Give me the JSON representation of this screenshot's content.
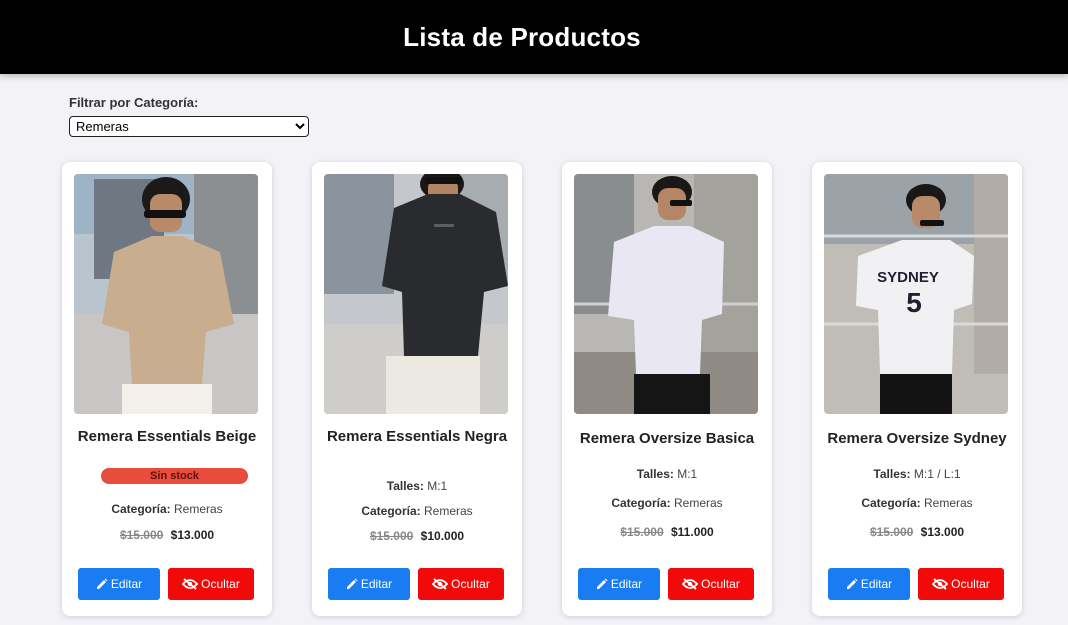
{
  "header": {
    "title": "Lista de Productos"
  },
  "filter": {
    "label": "Filtrar por Categoría:",
    "selected": "Remeras"
  },
  "labels": {
    "sizes": "Talles:",
    "category": "Categoría:",
    "edit": "Editar",
    "hide": "Ocultar"
  },
  "products": [
    {
      "name": "Remera Essentials Beige",
      "badge": "Sin stock",
      "category": "Remeras",
      "old_price": "$15.000",
      "price": "$13.000",
      "shirt_color": "#c8ad8e"
    },
    {
      "name": "Remera Essentials Negra",
      "sizes": "M:1",
      "category": "Remeras",
      "old_price": "$15.000",
      "price": "$10.000",
      "shirt_color": "#2a2b2e"
    },
    {
      "name": "Remera Oversize Basica",
      "sizes": "M:1",
      "category": "Remeras",
      "old_price": "$15.000",
      "price": "$11.000",
      "shirt_color": "#e9e8f2"
    },
    {
      "name": "Remera Oversize Sydney",
      "sizes": "M:1 / L:1",
      "category": "Remeras",
      "old_price": "$15.000",
      "price": "$13.000",
      "shirt_color": "#f1f1f4",
      "shirt_print": "SYDNEY",
      "shirt_number": "5"
    }
  ],
  "colors": {
    "header_bg": "#000000",
    "edit_button": "#1a7cf2",
    "hide_button": "#f20a0a",
    "badge": "#e74c3c"
  }
}
